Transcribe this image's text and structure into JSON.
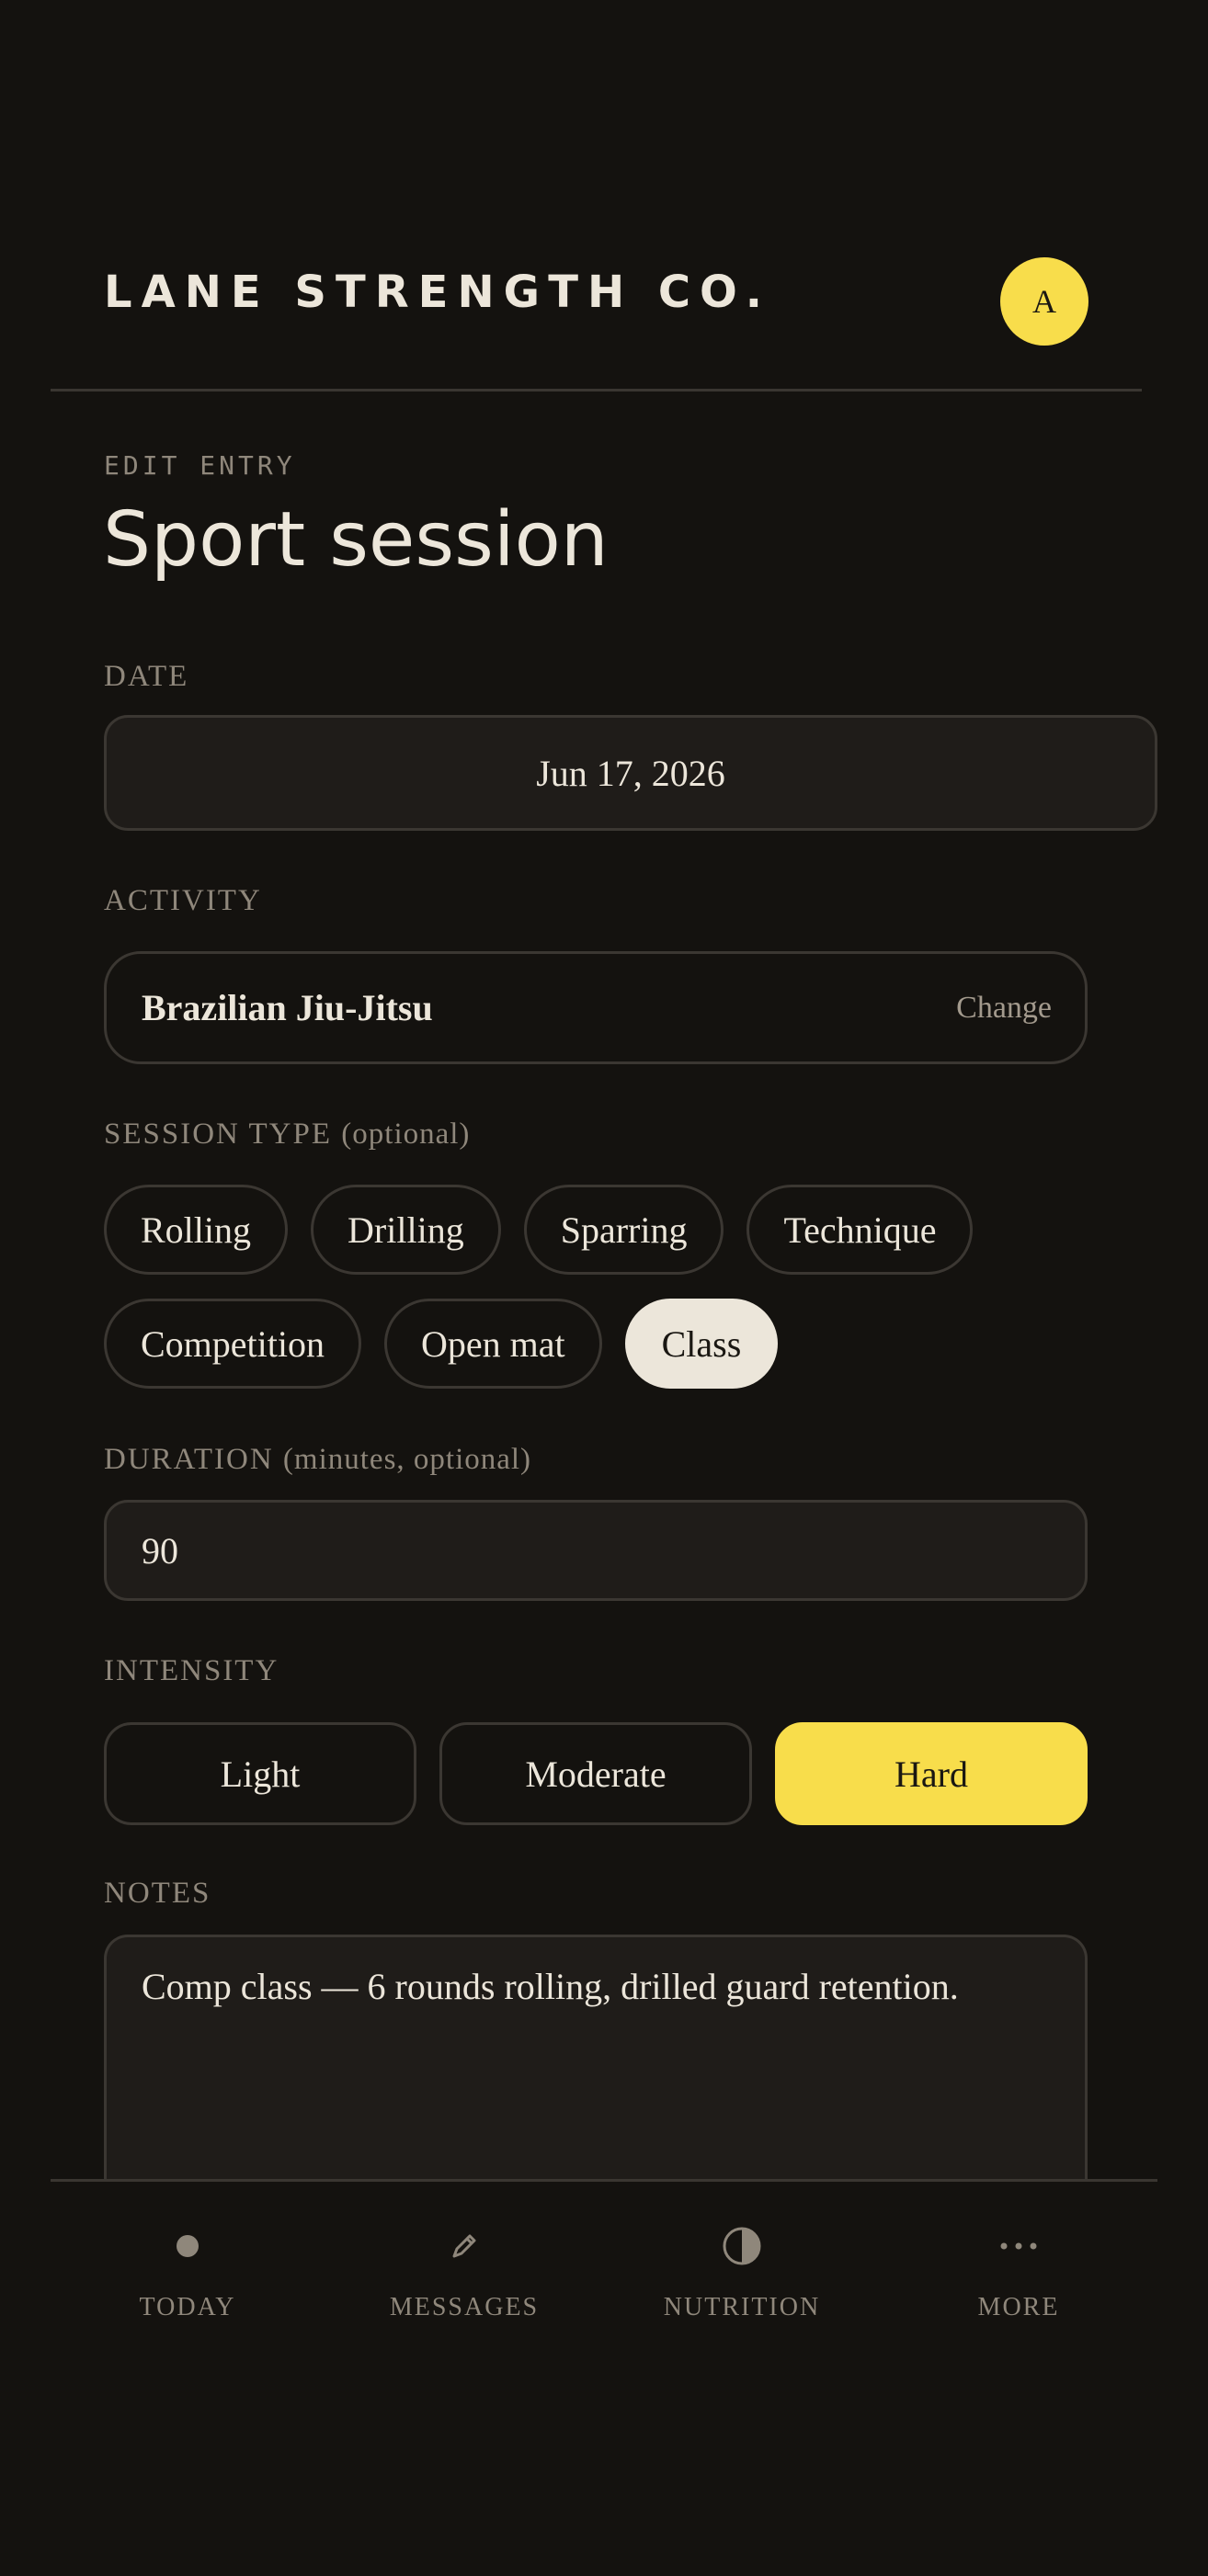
{
  "header": {
    "brand": "LANE STRENGTH CO.",
    "avatar_initial": "A"
  },
  "page": {
    "eyebrow": "EDIT ENTRY",
    "title": "Sport session"
  },
  "form": {
    "date": {
      "label": "DATE",
      "value": "Jun 17, 2026"
    },
    "activity": {
      "label": "ACTIVITY",
      "value": "Brazilian Jiu-Jitsu",
      "change_label": "Change"
    },
    "session_type": {
      "label": "SESSION TYPE",
      "label_suffix": "(optional)",
      "options": [
        "Rolling",
        "Drilling",
        "Sparring",
        "Technique",
        "Competition",
        "Open mat",
        "Class"
      ],
      "selected": "Class"
    },
    "duration": {
      "label": "DURATION",
      "label_suffix": "(minutes, optional)",
      "value": "90"
    },
    "intensity": {
      "label": "INTENSITY",
      "options": [
        "Light",
        "Moderate",
        "Hard"
      ],
      "selected": "Hard"
    },
    "notes": {
      "label": "NOTES",
      "value": "Comp class — 6 rounds rolling, drilled guard retention."
    }
  },
  "tabbar": {
    "items": [
      {
        "label": "TODAY",
        "icon": "dot-icon"
      },
      {
        "label": "MESSAGES",
        "icon": "pencil-icon"
      },
      {
        "label": "NUTRITION",
        "icon": "half-circle-icon"
      },
      {
        "label": "MORE",
        "icon": "more-dots-icon"
      }
    ]
  },
  "colors": {
    "background": "#14120f",
    "accent": "#f8dd4b",
    "text": "#ece6da",
    "muted": "#8f877b"
  }
}
